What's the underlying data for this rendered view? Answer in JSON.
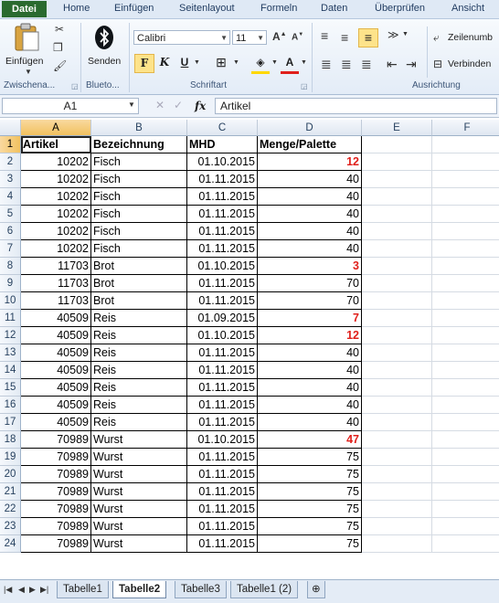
{
  "ribbon_tabs": [
    "Datei",
    "Home",
    "Einfügen",
    "Seitenlayout",
    "Formeln",
    "Daten",
    "Überprüfen",
    "Ansicht"
  ],
  "ribbon": {
    "paste_label": "Einfügen",
    "send_label": "Senden",
    "font_name": "Calibri",
    "font_size": "11",
    "wrap_label": "Zeilenumb",
    "merge_label": "Verbinden",
    "groups": {
      "clipboard": "Zwischena...",
      "bluetooth": "Blueto...",
      "font": "Schriftart",
      "alignment": "Ausrichtung"
    }
  },
  "formula_bar": {
    "name_box": "A1",
    "fx": "fx",
    "content": "Artikel"
  },
  "columns": [
    "A",
    "B",
    "C",
    "D",
    "E",
    "F"
  ],
  "headers": [
    "Artikel",
    "Bezeichnung",
    "MHD",
    "Menge/Palette"
  ],
  "rows": [
    [
      "10202",
      "Fisch",
      "01.10.2015",
      "12",
      true
    ],
    [
      "10202",
      "Fisch",
      "01.11.2015",
      "40",
      false
    ],
    [
      "10202",
      "Fisch",
      "01.11.2015",
      "40",
      false
    ],
    [
      "10202",
      "Fisch",
      "01.11.2015",
      "40",
      false
    ],
    [
      "10202",
      "Fisch",
      "01.11.2015",
      "40",
      false
    ],
    [
      "10202",
      "Fisch",
      "01.11.2015",
      "40",
      false
    ],
    [
      "11703",
      "Brot",
      "01.10.2015",
      "3",
      true
    ],
    [
      "11703",
      "Brot",
      "01.11.2015",
      "70",
      false
    ],
    [
      "11703",
      "Brot",
      "01.11.2015",
      "70",
      false
    ],
    [
      "40509",
      "Reis",
      "01.09.2015",
      "7",
      true
    ],
    [
      "40509",
      "Reis",
      "01.10.2015",
      "12",
      true
    ],
    [
      "40509",
      "Reis",
      "01.11.2015",
      "40",
      false
    ],
    [
      "40509",
      "Reis",
      "01.11.2015",
      "40",
      false
    ],
    [
      "40509",
      "Reis",
      "01.11.2015",
      "40",
      false
    ],
    [
      "40509",
      "Reis",
      "01.11.2015",
      "40",
      false
    ],
    [
      "40509",
      "Reis",
      "01.11.2015",
      "40",
      false
    ],
    [
      "70989",
      "Wurst",
      "01.10.2015",
      "47",
      true
    ],
    [
      "70989",
      "Wurst",
      "01.11.2015",
      "75",
      false
    ],
    [
      "70989",
      "Wurst",
      "01.11.2015",
      "75",
      false
    ],
    [
      "70989",
      "Wurst",
      "01.11.2015",
      "75",
      false
    ],
    [
      "70989",
      "Wurst",
      "01.11.2015",
      "75",
      false
    ],
    [
      "70989",
      "Wurst",
      "01.11.2015",
      "75",
      false
    ],
    [
      "70989",
      "Wurst",
      "01.11.2015",
      "75",
      false
    ]
  ],
  "sheet_tabs": [
    "Tabelle1",
    "Tabelle2",
    "Tabelle3",
    "Tabelle1 (2)"
  ],
  "active_sheet": "Tabelle2",
  "colors": {
    "highlight_red": "#e0201b",
    "datei_green": "#2a6a2f"
  }
}
